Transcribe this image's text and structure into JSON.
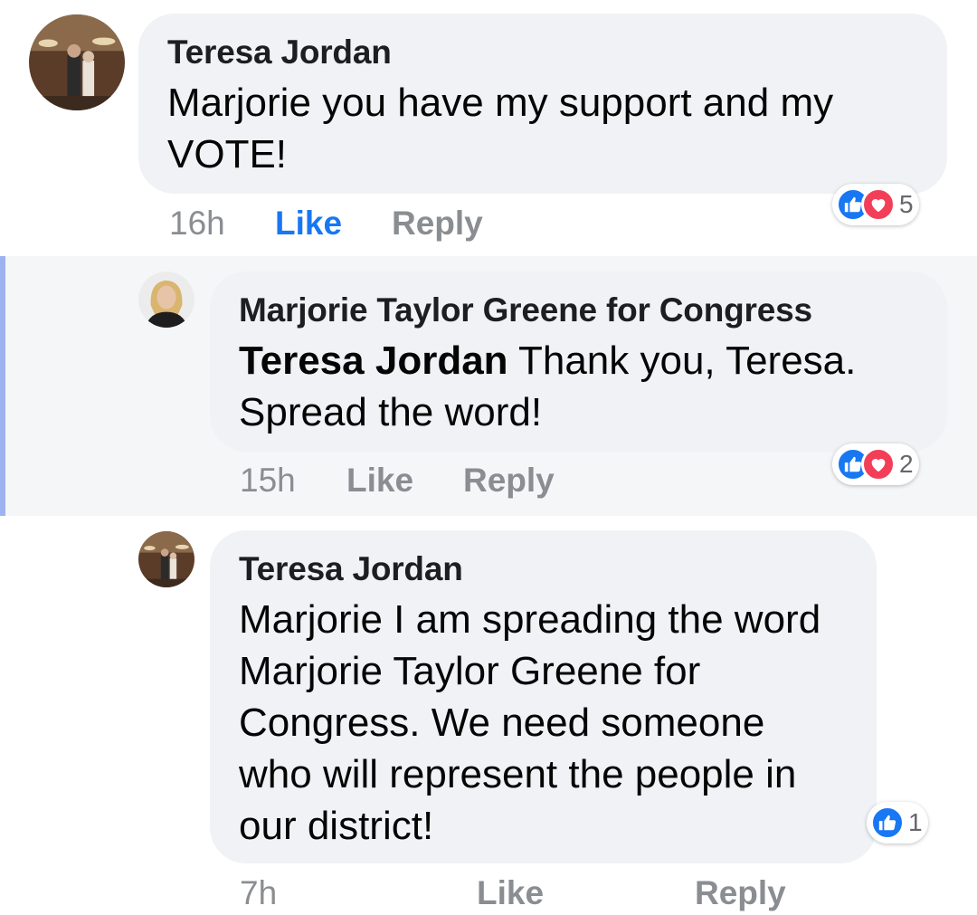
{
  "comments": [
    {
      "author": "Teresa Jordan",
      "text_line1": "Marjorie you have my support and my",
      "text_line2": "VOTE!",
      "time": "16h",
      "like_label": "Like",
      "reply_label": "Reply",
      "reaction_count": "5",
      "reaction_icons": [
        "like-icon",
        "love-icon"
      ]
    },
    {
      "author": "Marjorie Taylor Greene for Congress",
      "mention": "Teresa Jordan",
      "text_line1": " Thank you, Teresa.",
      "text_line2": "Spread the word!",
      "time": "15h",
      "like_label": "Like",
      "reply_label": "Reply",
      "reaction_count": "2",
      "reaction_icons": [
        "like-icon",
        "love-icon"
      ]
    },
    {
      "author": "Teresa Jordan",
      "text_lines": [
        "Marjorie I am spreading the word",
        "Marjorie Taylor Greene for",
        "Congress. We need someone",
        "who will represent the people in",
        "our district!"
      ],
      "time": "7h",
      "like_label": "Like",
      "reply_label": "Reply",
      "reaction_count": "1",
      "reaction_icons": [
        "like-icon"
      ]
    }
  ],
  "colors": {
    "bubble": "#f0f2f5",
    "like_blue": "#1877f2",
    "love_red": "#f33e58",
    "meta_gray": "#8a8d91",
    "reply_thread_bar": "#9db3f0"
  }
}
